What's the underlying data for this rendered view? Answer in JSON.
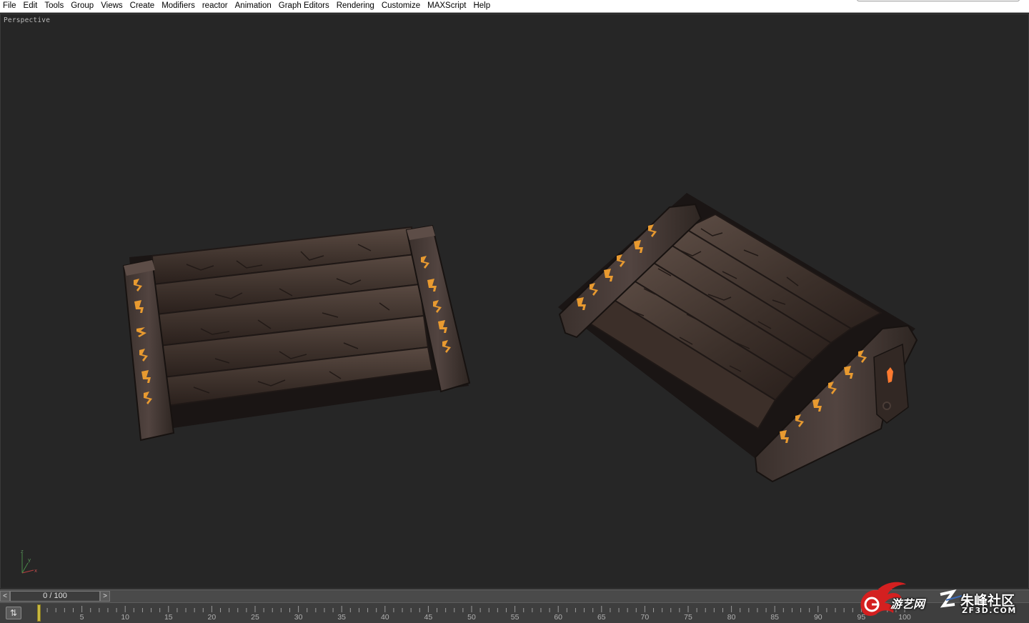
{
  "menubar": {
    "items": [
      "File",
      "Edit",
      "Tools",
      "Group",
      "Views",
      "Create",
      "Modifiers",
      "reactor",
      "Animation",
      "Graph Editors",
      "Rendering",
      "Customize",
      "MAXScript",
      "Help"
    ]
  },
  "viewport": {
    "label": "Perspective",
    "background_color": "#262626",
    "axis": {
      "x": "x",
      "y": "y",
      "z": "z"
    }
  },
  "timeslider": {
    "position_text": "0 / 100",
    "left_arrow": "<",
    "right_arrow": ">"
  },
  "trackbar": {
    "ticks": [
      "0",
      "5",
      "10",
      "15",
      "20",
      "25",
      "30",
      "35",
      "40",
      "45",
      "50",
      "55",
      "60",
      "65",
      "70",
      "75",
      "80",
      "85",
      "90",
      "95",
      "100"
    ],
    "current_frame": 0
  },
  "watermark": {
    "site1": "游艺网",
    "site2": "朱峰社区",
    "domain": "ZF3D.COM"
  },
  "colors": {
    "stone": "#4a3c36",
    "stone_dark": "#2c221e",
    "rune_glow": "#e89a30",
    "accent_red": "#d42020"
  }
}
